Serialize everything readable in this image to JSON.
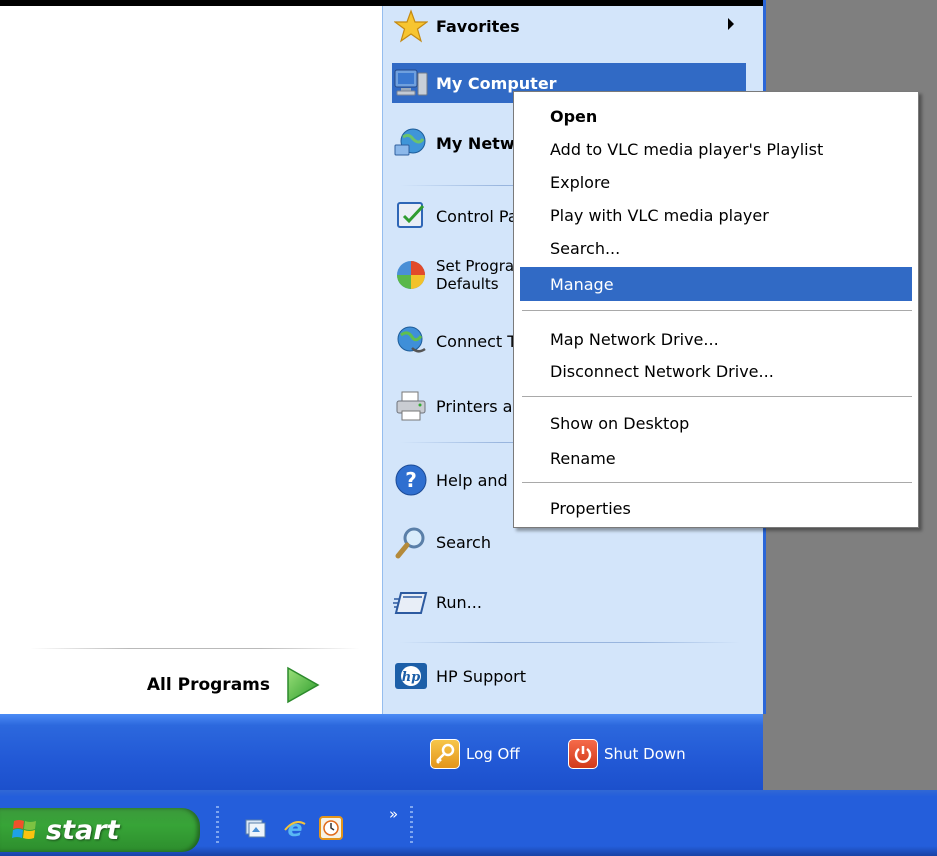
{
  "left_panel": {
    "all_programs_label": "All Programs"
  },
  "right_panel": {
    "items": [
      {
        "label": "Favorites",
        "icon": "star-icon",
        "has_submenu": true
      },
      {
        "label": "My Computer",
        "icon": "my-computer-icon",
        "highlighted": true
      },
      {
        "label": "My Network Places",
        "icon": "network-places-icon"
      },
      {
        "label": "Control Panel",
        "icon": "control-panel-icon"
      },
      {
        "label_line1": "Set Program Access and",
        "label_line2": "Defaults",
        "icon": "set-program-access-icon"
      },
      {
        "label": "Connect To",
        "icon": "connect-to-icon"
      },
      {
        "label": "Printers and Faxes",
        "icon": "printer-icon"
      },
      {
        "label": "Help and Support",
        "icon": "help-icon"
      },
      {
        "label": "Search",
        "icon": "search-icon"
      },
      {
        "label": "Run...",
        "icon": "run-icon"
      },
      {
        "label": "HP Support",
        "icon": "hp-logo-icon"
      }
    ]
  },
  "bottom": {
    "logoff_label": "Log Off",
    "shutdown_label": "Shut Down"
  },
  "taskbar": {
    "start_label": "start",
    "quick_launch": [
      "desktop-icon",
      "internet-explorer-icon",
      "clock-icon"
    ],
    "more_label": "»"
  },
  "context_menu": {
    "items": [
      {
        "label": "Open",
        "bold": true
      },
      {
        "label": "Add to VLC media player's Playlist"
      },
      {
        "label": "Explore"
      },
      {
        "label": "Play with VLC media player"
      },
      {
        "label": "Search..."
      },
      {
        "label": "Manage",
        "highlighted": true
      },
      {
        "label": "Map Network Drive..."
      },
      {
        "label": "Disconnect Network Drive..."
      },
      {
        "label": "Show on Desktop"
      },
      {
        "label": "Rename"
      },
      {
        "label": "Properties"
      }
    ]
  },
  "colors": {
    "menu_highlight": "#316ac5",
    "right_panel_bg": "#d3e5fa",
    "taskbar_blue": "#245edb",
    "start_green": "#37a437"
  }
}
